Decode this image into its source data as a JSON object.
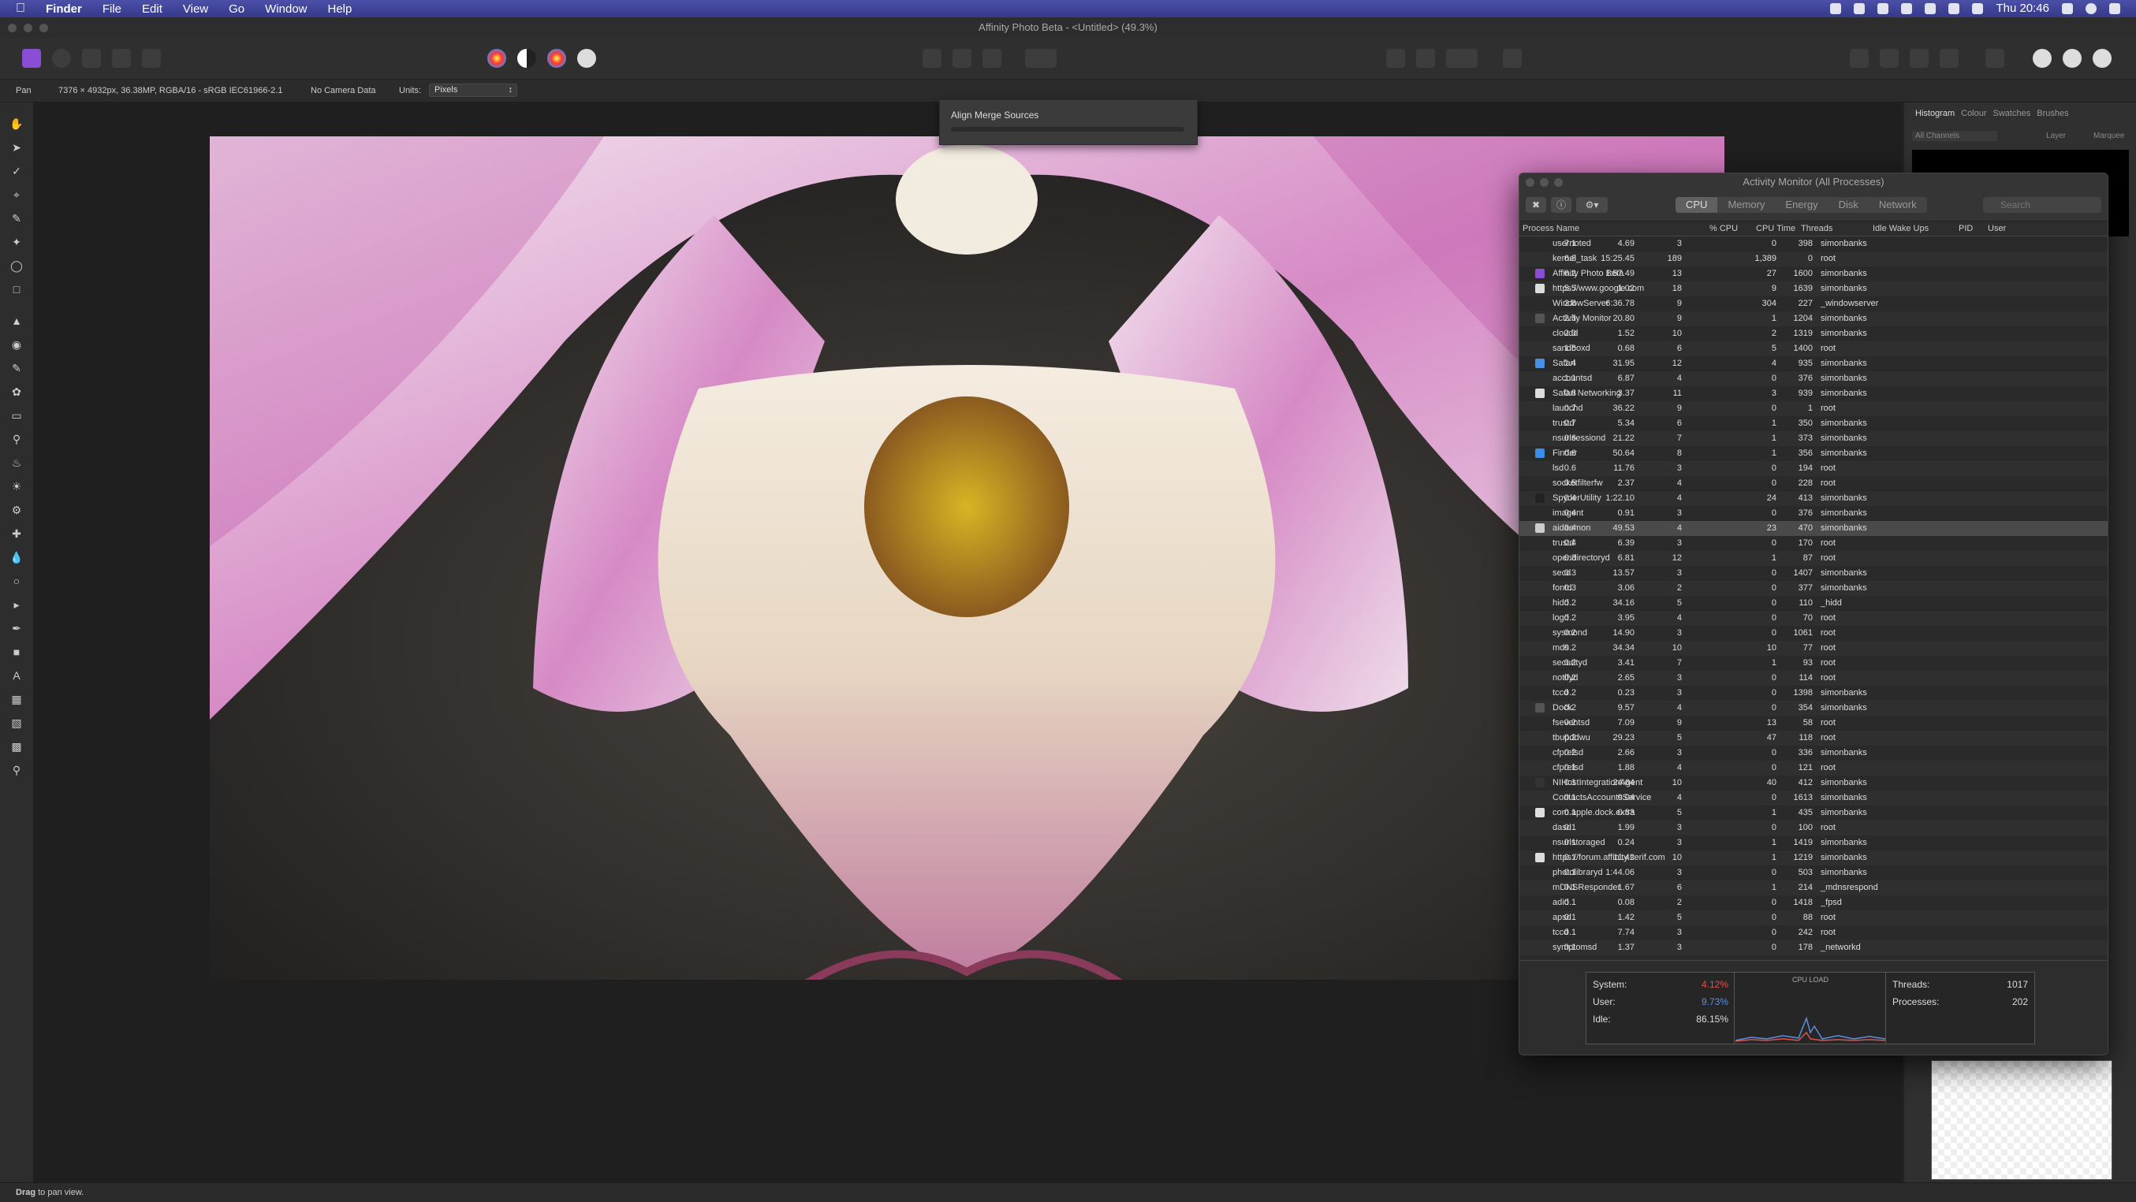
{
  "menubar": {
    "app": "Finder",
    "items": [
      "File",
      "Edit",
      "View",
      "Go",
      "Window",
      "Help"
    ],
    "clock": "Thu 20:46"
  },
  "window": {
    "title": "Affinity Photo Beta - <Untitled> (49.3%)"
  },
  "context": {
    "tool": "Pan",
    "doc_info": "7376 × 4932px, 36.38MP, RGBA/16 - sRGB IEC61966-2.1",
    "camera": "No Camera Data",
    "units_label": "Units:",
    "units_value": "Pixels"
  },
  "popup": {
    "label": "Align Merge Sources",
    "progress": 0
  },
  "right_panel": {
    "tabs": [
      "Histogram",
      "Colour",
      "Swatches",
      "Brushes"
    ],
    "channels": "All Channels",
    "layer_opt": "Layer",
    "marquee_opt": "Marquee"
  },
  "status": {
    "bold": "Drag",
    "text": " to pan view."
  },
  "activity_monitor": {
    "title": "Activity Monitor (All Processes)",
    "tabs": [
      "CPU",
      "Memory",
      "Energy",
      "Disk",
      "Network"
    ],
    "active_tab": "CPU",
    "search_placeholder": "Search",
    "columns": [
      "Process Name",
      "% CPU",
      "CPU Time",
      "Threads",
      "Idle Wake Ups",
      "PID",
      "User"
    ],
    "rows": [
      [
        "usernoted",
        "7.1",
        "4.69",
        "3",
        "0",
        "398",
        "simonbanks"
      ],
      [
        "kernel_task",
        "6.8",
        "15:25.45",
        "189",
        "1,389",
        "0",
        "root"
      ],
      [
        "Affinity Photo Beta",
        "6.2",
        "1:57.49",
        "13",
        "27",
        "1600",
        "simonbanks"
      ],
      [
        "https://www.google.com",
        "5.5",
        "1.02",
        "18",
        "9",
        "1639",
        "simonbanks"
      ],
      [
        "WindowServer",
        "2.8",
        "6:36.78",
        "9",
        "304",
        "227",
        "_windowserver"
      ],
      [
        "Activity Monitor",
        "2.5",
        "20.80",
        "9",
        "1",
        "1204",
        "simonbanks"
      ],
      [
        "cloudd",
        "2.0",
        "1.52",
        "10",
        "2",
        "1319",
        "simonbanks"
      ],
      [
        "sandboxd",
        "1.6",
        "0.68",
        "6",
        "5",
        "1400",
        "root"
      ],
      [
        "Safari",
        "1.4",
        "31.95",
        "12",
        "4",
        "935",
        "simonbanks"
      ],
      [
        "accountsd",
        "1.1",
        "6.87",
        "4",
        "0",
        "376",
        "simonbanks"
      ],
      [
        "Safari Networking",
        "0.8",
        "3.37",
        "11",
        "3",
        "939",
        "simonbanks"
      ],
      [
        "launchd",
        "0.7",
        "36.22",
        "9",
        "0",
        "1",
        "root"
      ],
      [
        "trustd",
        "0.7",
        "5.34",
        "6",
        "1",
        "350",
        "simonbanks"
      ],
      [
        "nsurlsessiond",
        "0.6",
        "21.22",
        "7",
        "1",
        "373",
        "simonbanks"
      ],
      [
        "Finder",
        "0.6",
        "50.64",
        "8",
        "1",
        "356",
        "simonbanks"
      ],
      [
        "lsd",
        "0.6",
        "11.76",
        "3",
        "0",
        "194",
        "root"
      ],
      [
        "socketfilterfw",
        "0.5",
        "2.37",
        "4",
        "0",
        "228",
        "root"
      ],
      [
        "SpyderUtility",
        "0.4",
        "1:22.10",
        "4",
        "24",
        "413",
        "simonbanks"
      ],
      [
        "imagent",
        "0.4",
        "0.91",
        "3",
        "0",
        "376",
        "simonbanks"
      ],
      [
        "aidaemon",
        "0.4",
        "49.53",
        "4",
        "23",
        "470",
        "simonbanks"
      ],
      [
        "trustd",
        "0.4",
        "6.39",
        "3",
        "0",
        "170",
        "root"
      ],
      [
        "opendirectoryd",
        "0.3",
        "6.81",
        "12",
        "1",
        "87",
        "root"
      ],
      [
        "secd",
        "0.3",
        "13.57",
        "3",
        "0",
        "1407",
        "simonbanks"
      ],
      [
        "fontd",
        "0.3",
        "3.06",
        "2",
        "0",
        "377",
        "simonbanks"
      ],
      [
        "hidd",
        "0.2",
        "34.16",
        "5",
        "0",
        "110",
        "_hidd"
      ],
      [
        "logd",
        "0.2",
        "3.95",
        "4",
        "0",
        "70",
        "root"
      ],
      [
        "sysmond",
        "0.2",
        "14.90",
        "3",
        "0",
        "1061",
        "root"
      ],
      [
        "mds",
        "0.2",
        "34.34",
        "10",
        "10",
        "77",
        "root"
      ],
      [
        "securityd",
        "0.2",
        "3.41",
        "7",
        "1",
        "93",
        "root"
      ],
      [
        "notifyd",
        "0.2",
        "2.65",
        "3",
        "0",
        "114",
        "root"
      ],
      [
        "tccd",
        "0.2",
        "0.23",
        "3",
        "0",
        "1398",
        "simonbanks"
      ],
      [
        "Dock",
        "0.2",
        "9.57",
        "4",
        "0",
        "354",
        "simonbanks"
      ],
      [
        "fseventsd",
        "0.2",
        "7.09",
        "9",
        "13",
        "58",
        "root"
      ],
      [
        "tbupddwu",
        "0.2",
        "29.23",
        "5",
        "47",
        "118",
        "root"
      ],
      [
        "cfprefsd",
        "0.2",
        "2.66",
        "3",
        "0",
        "336",
        "simonbanks"
      ],
      [
        "cfprefsd",
        "0.1",
        "1.88",
        "4",
        "0",
        "121",
        "root"
      ],
      [
        "NIHostIntegrationAgent",
        "0.1",
        "24.64",
        "10",
        "40",
        "412",
        "simonbanks"
      ],
      [
        "ContactsAccountsService",
        "0.1",
        "0.04",
        "4",
        "0",
        "1613",
        "simonbanks"
      ],
      [
        "com.apple.dock.extra",
        "0.1",
        "0.83",
        "5",
        "1",
        "435",
        "simonbanks"
      ],
      [
        "dasd",
        "0.1",
        "1.99",
        "3",
        "0",
        "100",
        "root"
      ],
      [
        "nsurlstoraged",
        "0.1",
        "0.24",
        "3",
        "1",
        "1419",
        "simonbanks"
      ],
      [
        "https://forum.affinity.serif.com",
        "0.1",
        "11.42",
        "10",
        "1",
        "1219",
        "simonbanks"
      ],
      [
        "photolibraryd",
        "0.1",
        "1:44.06",
        "3",
        "0",
        "503",
        "simonbanks"
      ],
      [
        "mDNSResponder",
        "0.1",
        "1.67",
        "6",
        "1",
        "214",
        "_mdnsrespond"
      ],
      [
        "adid",
        "0.1",
        "0.08",
        "2",
        "0",
        "1418",
        "_fpsd"
      ],
      [
        "apsd",
        "0.1",
        "1.42",
        "5",
        "0",
        "88",
        "root"
      ],
      [
        "tccd",
        "0.1",
        "7.74",
        "3",
        "0",
        "242",
        "root"
      ],
      [
        "symptomsd",
        "0.1",
        "1.37",
        "3",
        "0",
        "178",
        "_networkd"
      ]
    ],
    "selected_row": 19,
    "footer": {
      "system_label": "System:",
      "system_value": "4.12%",
      "user_label": "User:",
      "user_value": "9.73%",
      "idle_label": "Idle:",
      "idle_value": "86.15%",
      "cpu_load_label": "CPU LOAD",
      "threads_label": "Threads:",
      "threads_value": "1017",
      "processes_label": "Processes:",
      "processes_value": "202"
    }
  },
  "colors": {
    "accent": "#8a4dd6",
    "system": "#e0524e",
    "user": "#5b8fe0"
  }
}
